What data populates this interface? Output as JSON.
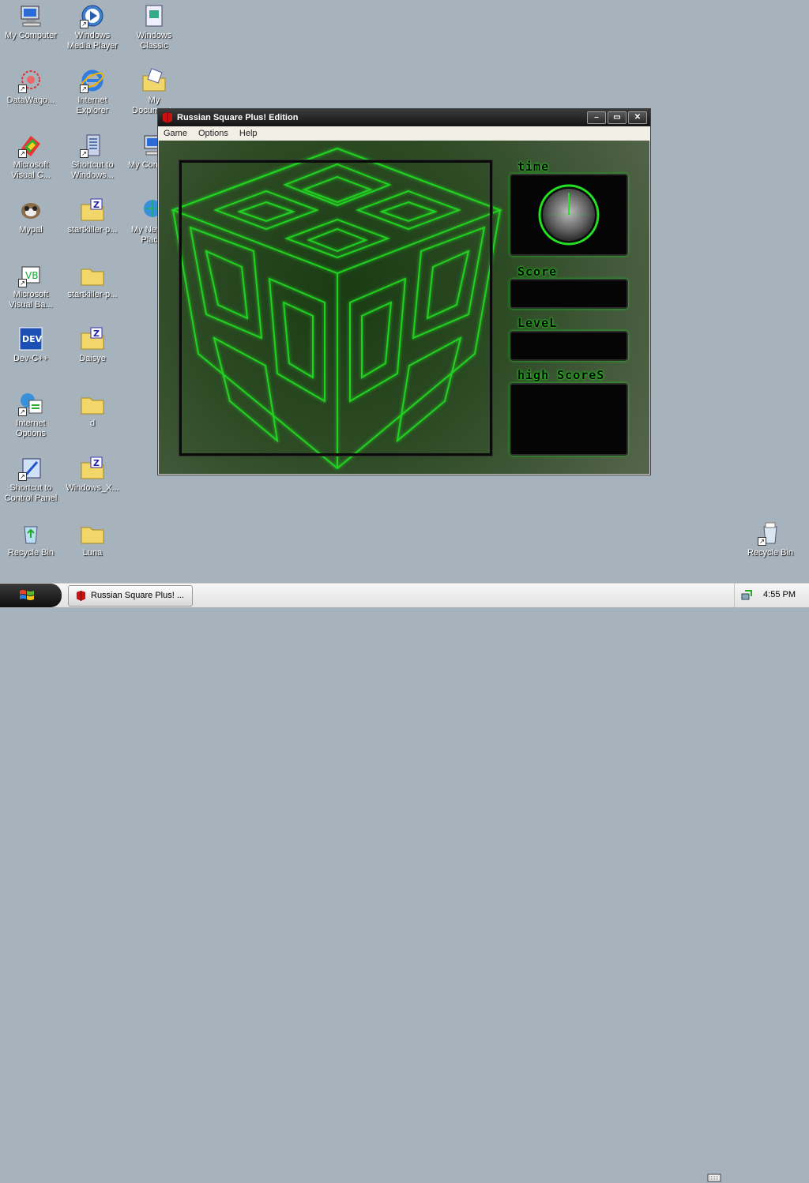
{
  "desktop": {
    "icons": [
      {
        "label": "My Computer",
        "icon": "my-computer-icon"
      },
      {
        "label": "Windows\nMedia Player",
        "icon": "media-player-icon"
      },
      {
        "label": "Windows\nClassic",
        "icon": "windows-classic-icon"
      },
      {
        "label": "DataWago...",
        "icon": "datawagon-icon"
      },
      {
        "label": "Internet\nExplorer",
        "icon": "internet-explorer-icon"
      },
      {
        "label": "My\nDocuments",
        "icon": "my-documents-icon"
      },
      {
        "label": "Microsoft\nVisual C...",
        "icon": "visual-c-icon"
      },
      {
        "label": "Shortcut to\nWindows...",
        "icon": "shortcut-windows-icon"
      },
      {
        "label": "My Computer",
        "icon": "my-computer-2-icon"
      },
      {
        "label": "Mypal",
        "icon": "mypal-icon"
      },
      {
        "label": "startkiller-p...",
        "icon": "zip-folder-icon"
      },
      {
        "label": "My Network\nPlaces",
        "icon": "network-places-icon"
      },
      {
        "label": "Microsoft\nVisual Ba...",
        "icon": "visual-basic-icon"
      },
      {
        "label": "startkiller-p...",
        "icon": "folder-icon"
      },
      {
        "label": "Dev-C++",
        "icon": "dev-cpp-icon"
      },
      {
        "label": "Daisye",
        "icon": "zip-folder-icon"
      },
      {
        "label": "Internet\nOptions",
        "icon": "internet-options-icon"
      },
      {
        "label": "d",
        "icon": "folder-icon"
      },
      {
        "label": "Shortcut to\nControl Panel",
        "icon": "control-panel-icon"
      },
      {
        "label": "Windows_X...",
        "icon": "zip-folder-icon"
      },
      {
        "label": "Recycle Bin",
        "icon": "recycle-bin-icon"
      },
      {
        "label": "Luna",
        "icon": "folder-icon"
      },
      {
        "label": "Recycle Bin",
        "icon": "recycle-bin-full-icon"
      }
    ]
  },
  "window": {
    "title": "Russian Square Plus! Edition",
    "menu": [
      "Game",
      "Options",
      "Help"
    ],
    "controls": {
      "minimize": "–",
      "maximize": "▭",
      "close": "✕"
    },
    "panels": {
      "time_label": "time",
      "score_label": "Score",
      "level_label": "LeveL",
      "high_scores_label": "high ScoreS"
    },
    "accent_color": "#1aff1a"
  },
  "taskbar": {
    "task_label": "Russian Square Plus! ...",
    "clock": "4:55 PM"
  }
}
